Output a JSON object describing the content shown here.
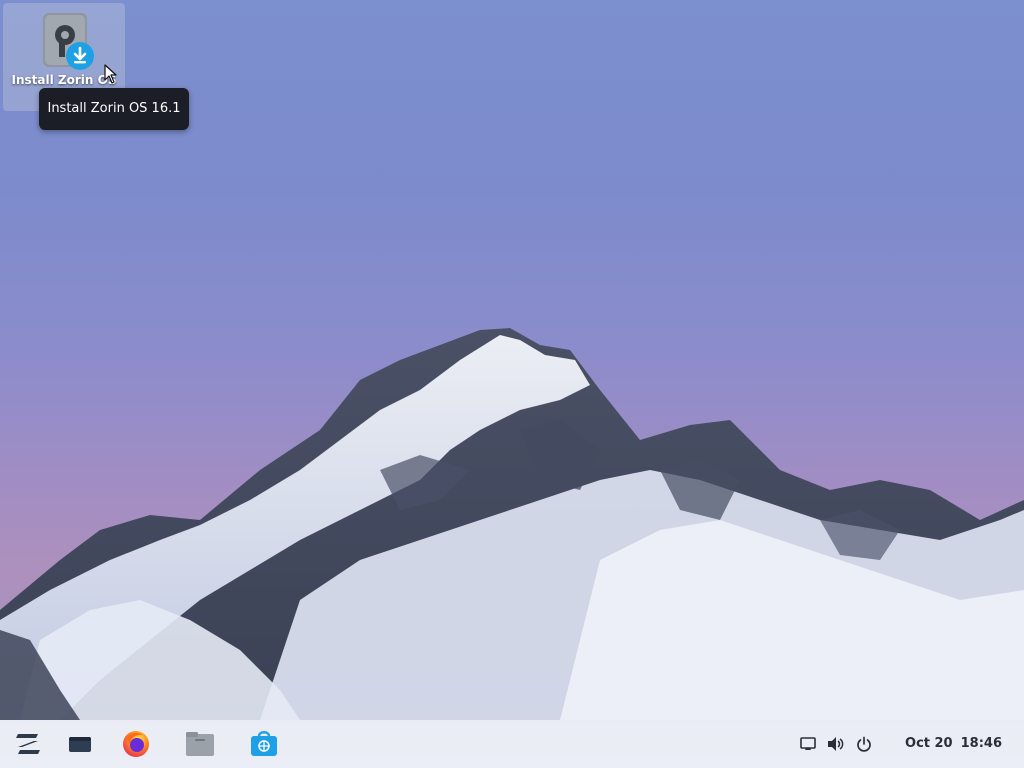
{
  "desktop": {
    "icons": [
      {
        "label": "Install Zorin OS",
        "icon": "disk-installer-icon",
        "badge": "download-arrow-icon"
      }
    ],
    "tooltip": "Install Zorin OS 16.1"
  },
  "taskbar": {
    "launchers": [
      {
        "name": "zorin-menu",
        "icon": "zorin-logo-icon"
      },
      {
        "name": "workspaces",
        "icon": "window-icon"
      },
      {
        "name": "firefox",
        "icon": "firefox-icon"
      },
      {
        "name": "files",
        "icon": "folder-icon"
      },
      {
        "name": "software",
        "icon": "software-store-icon"
      }
    ],
    "tray": [
      {
        "name": "notifications",
        "icon": "screen-icon"
      },
      {
        "name": "volume",
        "icon": "speaker-icon"
      },
      {
        "name": "power",
        "icon": "power-icon"
      }
    ],
    "clock": {
      "date": "Oct 20",
      "time": "18:46"
    }
  },
  "colors": {
    "taskbar_bg": "#eef0f6",
    "tooltip_bg": "#1b1e26",
    "accent_blue": "#1ea0e6"
  }
}
